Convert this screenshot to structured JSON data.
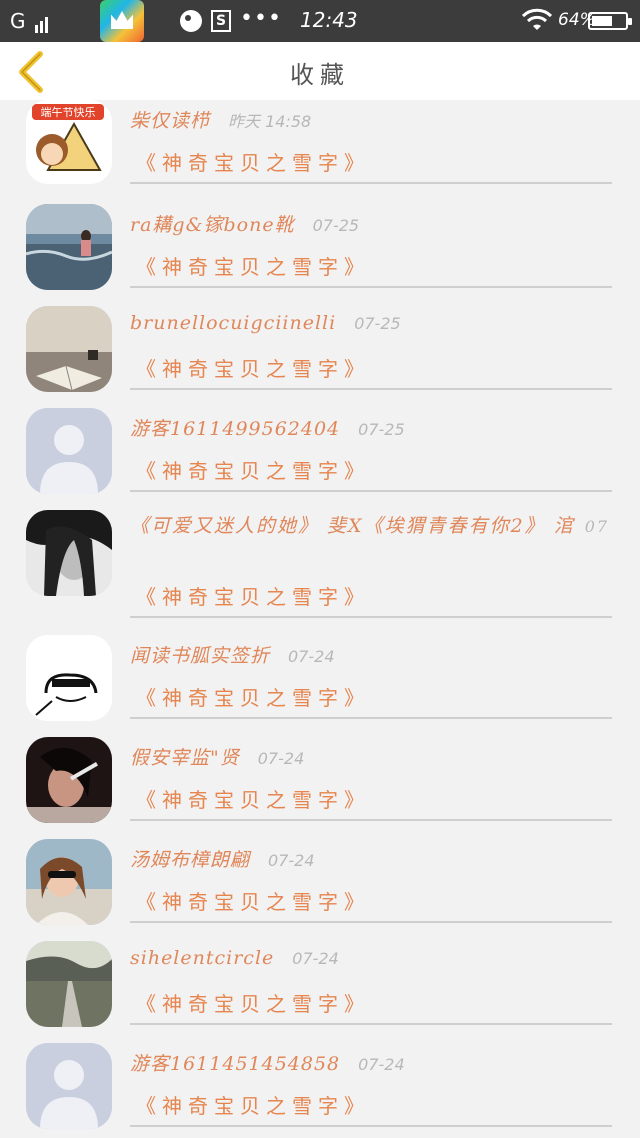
{
  "status_bar": {
    "signal": "G",
    "time": "12:43",
    "battery": "64%",
    "battery_level": 0.64,
    "dots": "•••",
    "s_icon": "S"
  },
  "header": {
    "title": "收藏",
    "back_icon": "chevron-left-icon"
  },
  "colors": {
    "accent": "#e6854f",
    "nickname": "#e0875a",
    "time": "#b8b8b8",
    "back_chevron": "#f2c12e"
  },
  "items": [
    {
      "nickname": "柴仅读栉",
      "time": "昨天 14:58",
      "book": "《神奇宝贝之雪字》",
      "avatar": "festival-cartoon"
    },
    {
      "nickname": "ra耩g&镓bone靴",
      "time": "07-25",
      "book": "《神奇宝贝之雪字》",
      "avatar": "beach-photo"
    },
    {
      "nickname": "brunellocuigciinelli",
      "time": "07-25",
      "book": "《神奇宝贝之雪字》",
      "avatar": "book-table"
    },
    {
      "nickname": "游客1611499562404",
      "time": "07-25",
      "book": "《神奇宝贝之雪字》",
      "avatar": "default-user"
    },
    {
      "nickname": "《可爱又迷人的她》 斐X《埃猬青春有你2》 涫",
      "time": "07",
      "book": "《神奇宝贝之雪字》",
      "avatar": "bw-girl"
    },
    {
      "nickname": "闻读书胍实签折",
      "time": "07-24",
      "book": "《神奇宝贝之雪字》",
      "avatar": "sketch-face"
    },
    {
      "nickname": "假安宰监\"贤",
      "time": "07-24",
      "book": "《神奇宝贝之雪字》",
      "avatar": "dark-portrait"
    },
    {
      "nickname": "汤姆布樟朗翩",
      "time": "07-24",
      "book": "《神奇宝贝之雪字》",
      "avatar": "sunglasses-girl"
    },
    {
      "nickname": "sihelentcircle",
      "time": "07-24",
      "book": "《神奇宝贝之雪字》",
      "avatar": "road-landscape"
    },
    {
      "nickname": "游客1611451454858",
      "time": "07-24",
      "book": "《神奇宝贝之雪字》",
      "avatar": "default-user"
    }
  ]
}
